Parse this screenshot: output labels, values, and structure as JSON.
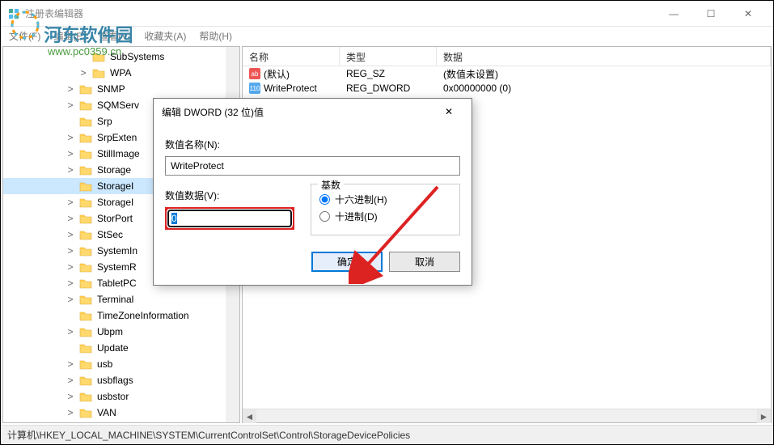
{
  "window": {
    "title": "注册表编辑器",
    "minimize": "—",
    "maximize": "☐",
    "close": "✕"
  },
  "menu": {
    "file": "文件(F)",
    "edit": "编辑(E)",
    "view": "查看(V)",
    "favorites": "收藏夹(A)",
    "help": "帮助(H)"
  },
  "watermark": {
    "text": "河东软件园",
    "url": "www.pc0359.cn"
  },
  "tree": {
    "items": [
      {
        "indent": 92,
        "chev": "",
        "label": "SubSystems"
      },
      {
        "indent": 92,
        "chev": ">",
        "label": "WPA"
      },
      {
        "indent": 76,
        "chev": ">",
        "label": "SNMP"
      },
      {
        "indent": 76,
        "chev": ">",
        "label": "SQMServ"
      },
      {
        "indent": 76,
        "chev": "",
        "label": "Srp"
      },
      {
        "indent": 76,
        "chev": ">",
        "label": "SrpExten"
      },
      {
        "indent": 76,
        "chev": ">",
        "label": "StillImage"
      },
      {
        "indent": 76,
        "chev": ">",
        "label": "Storage"
      },
      {
        "indent": 76,
        "chev": "",
        "label": "StorageI",
        "selected": true
      },
      {
        "indent": 76,
        "chev": ">",
        "label": "StorageI"
      },
      {
        "indent": 76,
        "chev": ">",
        "label": "StorPort"
      },
      {
        "indent": 76,
        "chev": ">",
        "label": "StSec"
      },
      {
        "indent": 76,
        "chev": ">",
        "label": "SystemIn"
      },
      {
        "indent": 76,
        "chev": ">",
        "label": "SystemR"
      },
      {
        "indent": 76,
        "chev": ">",
        "label": "TabletPC"
      },
      {
        "indent": 76,
        "chev": ">",
        "label": "Terminal"
      },
      {
        "indent": 76,
        "chev": "",
        "label": "TimeZoneInformation"
      },
      {
        "indent": 76,
        "chev": ">",
        "label": "Ubpm"
      },
      {
        "indent": 76,
        "chev": "",
        "label": "Update"
      },
      {
        "indent": 76,
        "chev": ">",
        "label": "usb"
      },
      {
        "indent": 76,
        "chev": ">",
        "label": "usbflags"
      },
      {
        "indent": 76,
        "chev": ">",
        "label": "usbstor"
      },
      {
        "indent": 76,
        "chev": ">",
        "label": "VAN"
      }
    ]
  },
  "list": {
    "headers": {
      "name": "名称",
      "type": "类型",
      "data": "数据"
    },
    "rows": [
      {
        "icon": "ab",
        "name": "(默认)",
        "type": "REG_SZ",
        "data": "(数值未设置)"
      },
      {
        "icon": "bin",
        "name": "WriteProtect",
        "type": "REG_DWORD",
        "data": "0x00000000 (0)"
      }
    ]
  },
  "statusbar": {
    "path": "计算机\\HKEY_LOCAL_MACHINE\\SYSTEM\\CurrentControlSet\\Control\\StorageDevicePolicies"
  },
  "dialog": {
    "title": "编辑 DWORD (32 位)值",
    "close": "✕",
    "name_label": "数值名称(N):",
    "name_value": "WriteProtect",
    "value_label": "数值数据(V):",
    "value_value": "0",
    "radix_label": "基数",
    "radix_hex": "十六进制(H)",
    "radix_dec": "十进制(D)",
    "ok": "确定",
    "cancel": "取消"
  }
}
